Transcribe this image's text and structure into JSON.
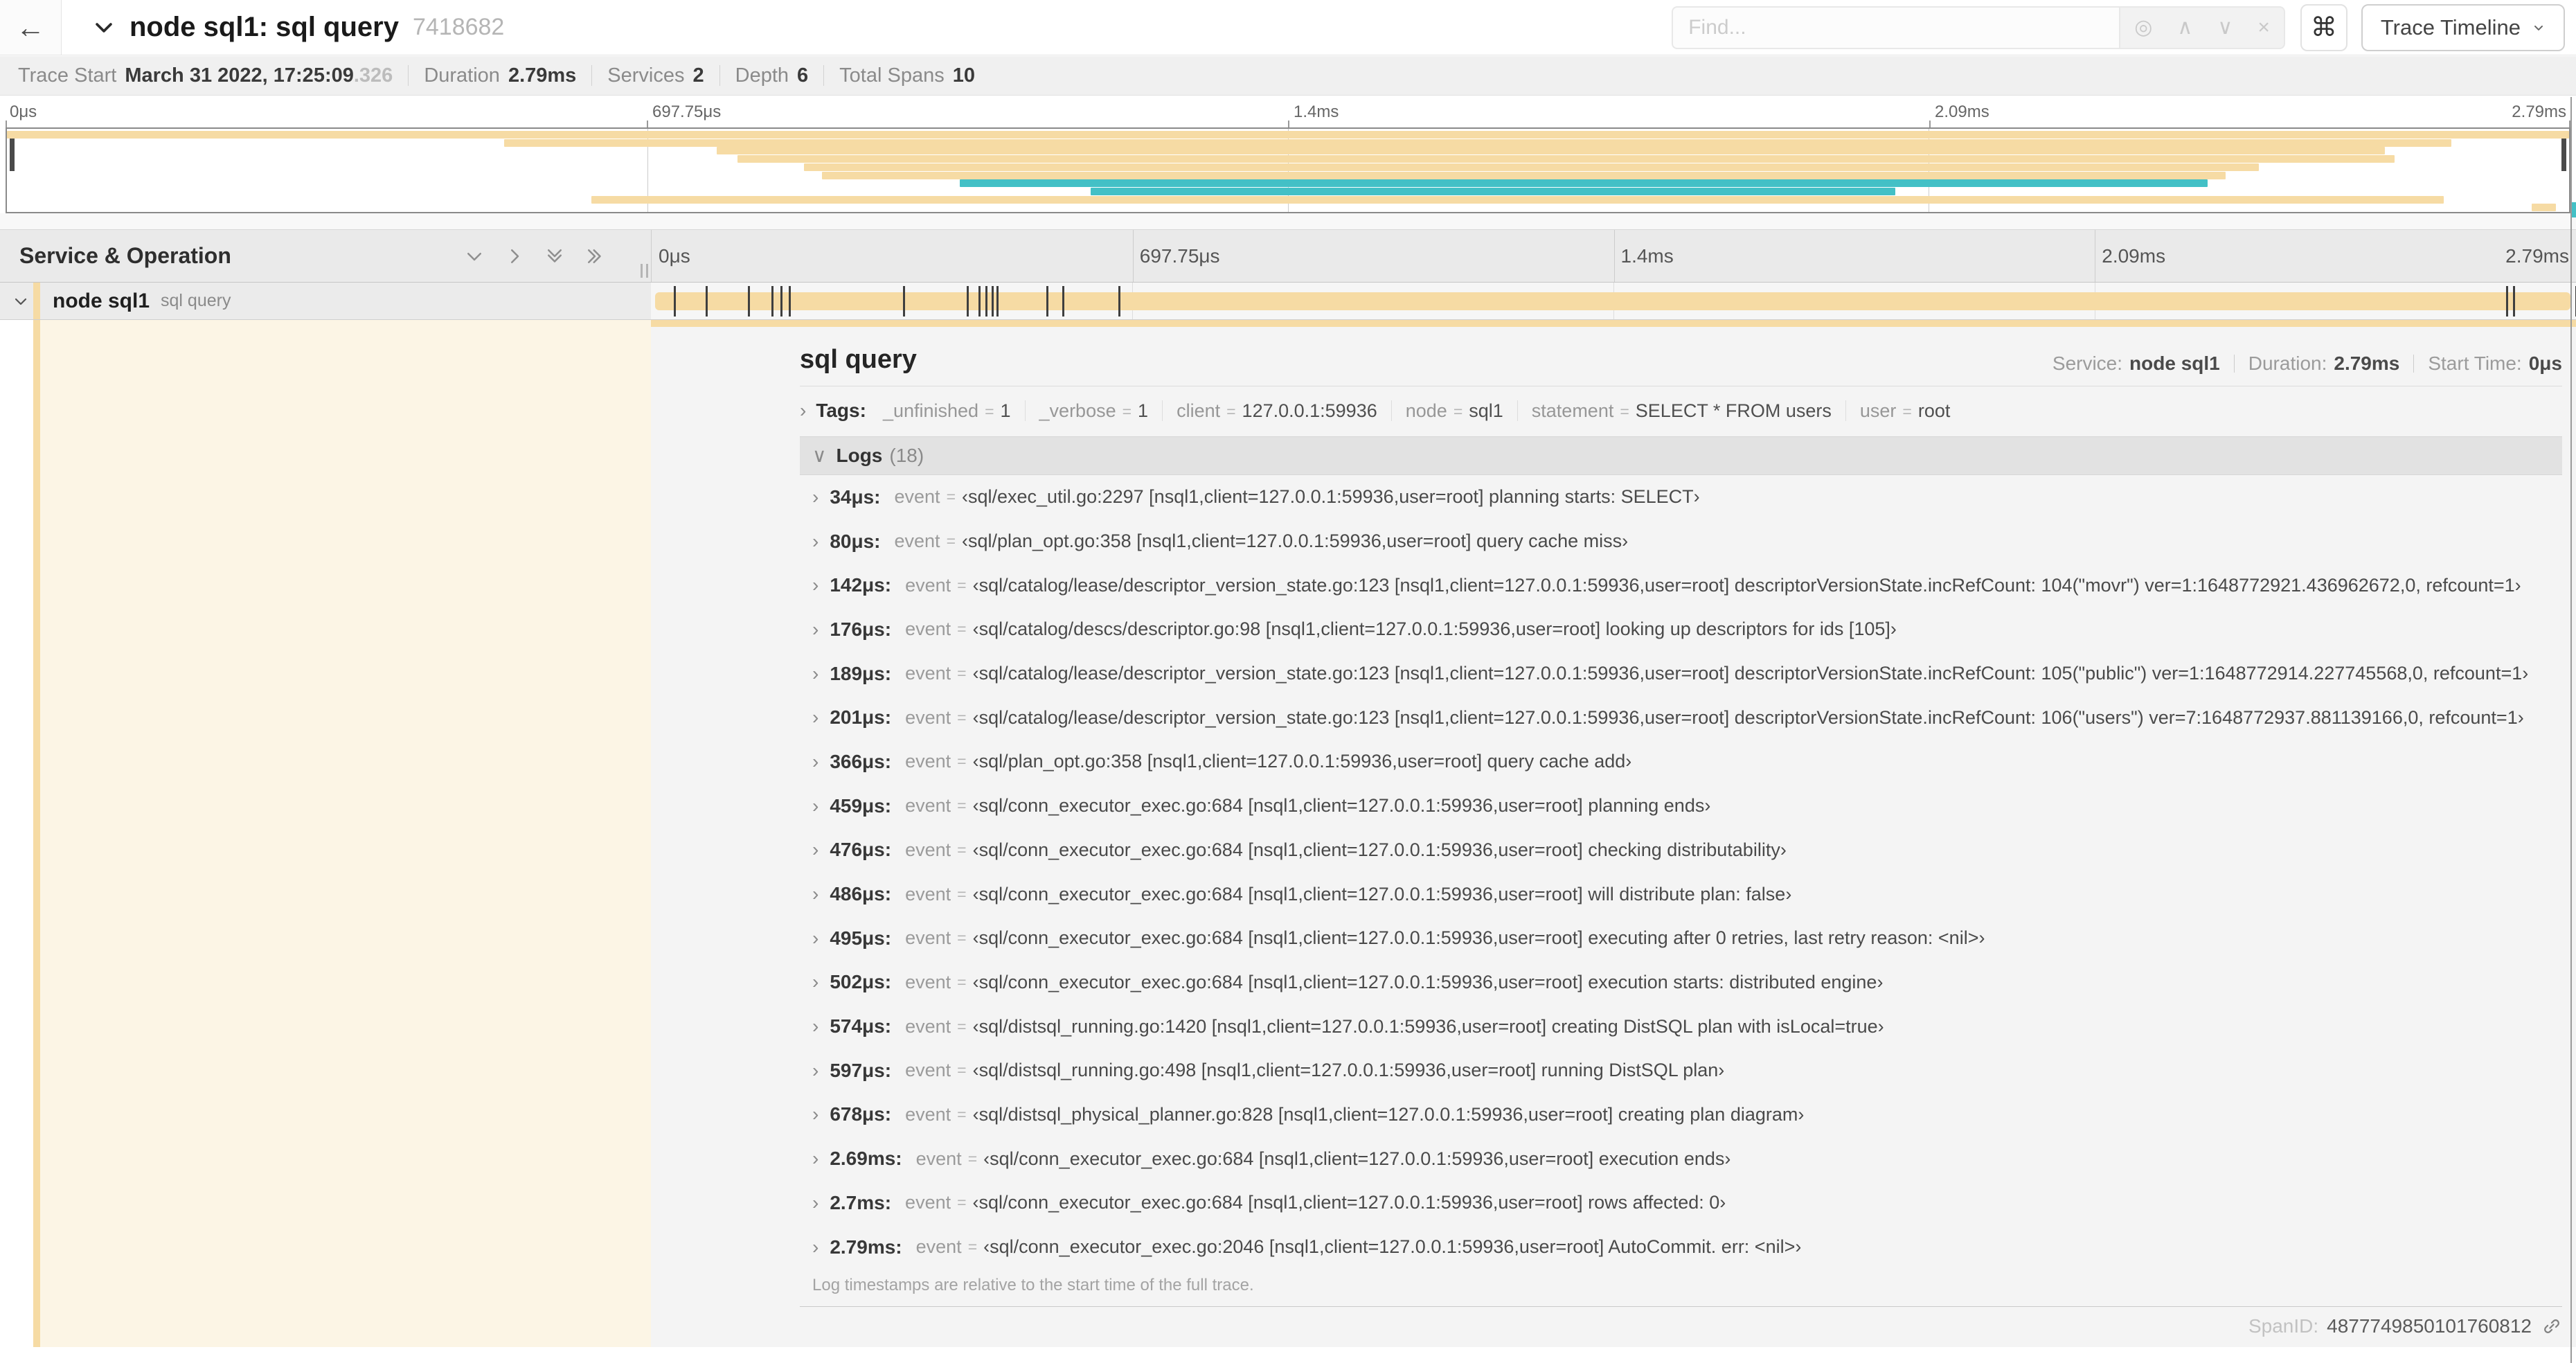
{
  "colors": {
    "accent_tan": "#f6dba4",
    "accent_teal": "#43c0c6",
    "left_panel_cream": "#fcf5e5",
    "detail_bg": "#f4f4f4"
  },
  "topbar": {
    "back_glyph": "←",
    "title": "node sql1: sql query",
    "trace_id": "7418682",
    "find_placeholder": "Find...",
    "find_icons": [
      {
        "name": "locate-span-icon",
        "glyph": "◎"
      },
      {
        "name": "prev-match-icon",
        "glyph": "∧"
      },
      {
        "name": "next-match-icon",
        "glyph": "∨"
      },
      {
        "name": "clear-find-icon",
        "glyph": "×"
      }
    ],
    "shortcut_glyph": "⌘",
    "view_dropdown_label": "Trace Timeline"
  },
  "infobar": {
    "items": [
      {
        "label": "Trace Start",
        "value": "March 31 2022, 17:25:09",
        "muted": ".326"
      },
      {
        "label": "Duration",
        "value": "2.79ms",
        "muted": ""
      },
      {
        "label": "Services",
        "value": "2",
        "muted": ""
      },
      {
        "label": "Depth",
        "value": "6",
        "muted": ""
      },
      {
        "label": "Total Spans",
        "value": "10",
        "muted": ""
      }
    ]
  },
  "time_ticks": [
    "0μs",
    "697.75μs",
    "1.4ms",
    "2.09ms",
    "2.79ms"
  ],
  "minimap": {
    "spans": [
      {
        "s": 0.0,
        "e": 1.0,
        "c": "tan"
      },
      {
        "s": 0.194,
        "e": 0.954,
        "c": "tan"
      },
      {
        "s": 0.277,
        "e": 0.928,
        "c": "tan"
      },
      {
        "s": 0.285,
        "e": 0.932,
        "c": "tan"
      },
      {
        "s": 0.311,
        "e": 0.879,
        "c": "tan"
      },
      {
        "s": 0.318,
        "e": 0.866,
        "c": "tan"
      },
      {
        "s": 0.372,
        "e": 0.859,
        "c": "teal"
      },
      {
        "s": 0.423,
        "e": 0.737,
        "c": "teal"
      },
      {
        "s": 0.228,
        "e": 0.951,
        "c": "tan"
      },
      {
        "s": 0.9855,
        "e": 0.995,
        "c": "tan"
      }
    ]
  },
  "timeline": {
    "left_header": "Service & Operation",
    "row": {
      "service": "node sql1",
      "operation": "sql query"
    },
    "duration_us": 2790,
    "marker_times_us": [
      34,
      80,
      142,
      176,
      189,
      201,
      366,
      459,
      476,
      486,
      495,
      502,
      574,
      597,
      678,
      2690,
      2700,
      2790
    ]
  },
  "detail": {
    "title": "sql query",
    "meta": [
      {
        "label": "Service:",
        "value": "node sql1"
      },
      {
        "label": "Duration:",
        "value": "2.79ms"
      },
      {
        "label": "Start Time:",
        "value": "0μs"
      }
    ],
    "tags_label": "Tags:",
    "tags": [
      {
        "key": "_unfinished",
        "value": "1"
      },
      {
        "key": "_verbose",
        "value": "1"
      },
      {
        "key": "client",
        "value": "127.0.0.1:59936"
      },
      {
        "key": "node",
        "value": "sql1"
      },
      {
        "key": "statement",
        "value": "SELECT * FROM users"
      },
      {
        "key": "user",
        "value": "root"
      }
    ],
    "logs_label": "Logs",
    "logs_count": "(18)",
    "logs": [
      {
        "time": "34μs:",
        "key": "event",
        "value": "‹sql/exec_util.go:2297 [nsql1,client=127.0.0.1:59936,user=root] planning starts: SELECT›"
      },
      {
        "time": "80μs:",
        "key": "event",
        "value": "‹sql/plan_opt.go:358 [nsql1,client=127.0.0.1:59936,user=root] query cache miss›"
      },
      {
        "time": "142μs:",
        "key": "event",
        "value": "‹sql/catalog/lease/descriptor_version_state.go:123 [nsql1,client=127.0.0.1:59936,user=root] descriptorVersionState.incRefCount: 104(\"movr\") ver=1:1648772921.436962672,0, refcount=1›"
      },
      {
        "time": "176μs:",
        "key": "event",
        "value": "‹sql/catalog/descs/descriptor.go:98 [nsql1,client=127.0.0.1:59936,user=root] looking up descriptors for ids [105]›"
      },
      {
        "time": "189μs:",
        "key": "event",
        "value": "‹sql/catalog/lease/descriptor_version_state.go:123 [nsql1,client=127.0.0.1:59936,user=root] descriptorVersionState.incRefCount: 105(\"public\") ver=1:1648772914.227745568,0, refcount=1›"
      },
      {
        "time": "201μs:",
        "key": "event",
        "value": "‹sql/catalog/lease/descriptor_version_state.go:123 [nsql1,client=127.0.0.1:59936,user=root] descriptorVersionState.incRefCount: 106(\"users\") ver=7:1648772937.881139166,0, refcount=1›"
      },
      {
        "time": "366μs:",
        "key": "event",
        "value": "‹sql/plan_opt.go:358 [nsql1,client=127.0.0.1:59936,user=root] query cache add›"
      },
      {
        "time": "459μs:",
        "key": "event",
        "value": "‹sql/conn_executor_exec.go:684 [nsql1,client=127.0.0.1:59936,user=root] planning ends›"
      },
      {
        "time": "476μs:",
        "key": "event",
        "value": "‹sql/conn_executor_exec.go:684 [nsql1,client=127.0.0.1:59936,user=root] checking distributability›"
      },
      {
        "time": "486μs:",
        "key": "event",
        "value": "‹sql/conn_executor_exec.go:684 [nsql1,client=127.0.0.1:59936,user=root] will distribute plan: false›"
      },
      {
        "time": "495μs:",
        "key": "event",
        "value": "‹sql/conn_executor_exec.go:684 [nsql1,client=127.0.0.1:59936,user=root] executing after 0 retries, last retry reason: <nil>›"
      },
      {
        "time": "502μs:",
        "key": "event",
        "value": "‹sql/conn_executor_exec.go:684 [nsql1,client=127.0.0.1:59936,user=root] execution starts: distributed engine›"
      },
      {
        "time": "574μs:",
        "key": "event",
        "value": "‹sql/distsql_running.go:1420 [nsql1,client=127.0.0.1:59936,user=root] creating DistSQL plan with isLocal=true›"
      },
      {
        "time": "597μs:",
        "key": "event",
        "value": "‹sql/distsql_running.go:498 [nsql1,client=127.0.0.1:59936,user=root] running DistSQL plan›"
      },
      {
        "time": "678μs:",
        "key": "event",
        "value": "‹sql/distsql_physical_planner.go:828 [nsql1,client=127.0.0.1:59936,user=root] creating plan diagram›"
      },
      {
        "time": "2.69ms:",
        "key": "event",
        "value": "‹sql/conn_executor_exec.go:684 [nsql1,client=127.0.0.1:59936,user=root] execution ends›"
      },
      {
        "time": "2.7ms:",
        "key": "event",
        "value": "‹sql/conn_executor_exec.go:684 [nsql1,client=127.0.0.1:59936,user=root] rows affected: 0›"
      },
      {
        "time": "2.79ms:",
        "key": "event",
        "value": "‹sql/conn_executor_exec.go:2046 [nsql1,client=127.0.0.1:59936,user=root] AutoCommit. err: <nil>›"
      }
    ],
    "logs_footnote": "Log timestamps are relative to the start time of the full trace.",
    "span_id_label": "SpanID:",
    "span_id": "4877749850101760812"
  }
}
